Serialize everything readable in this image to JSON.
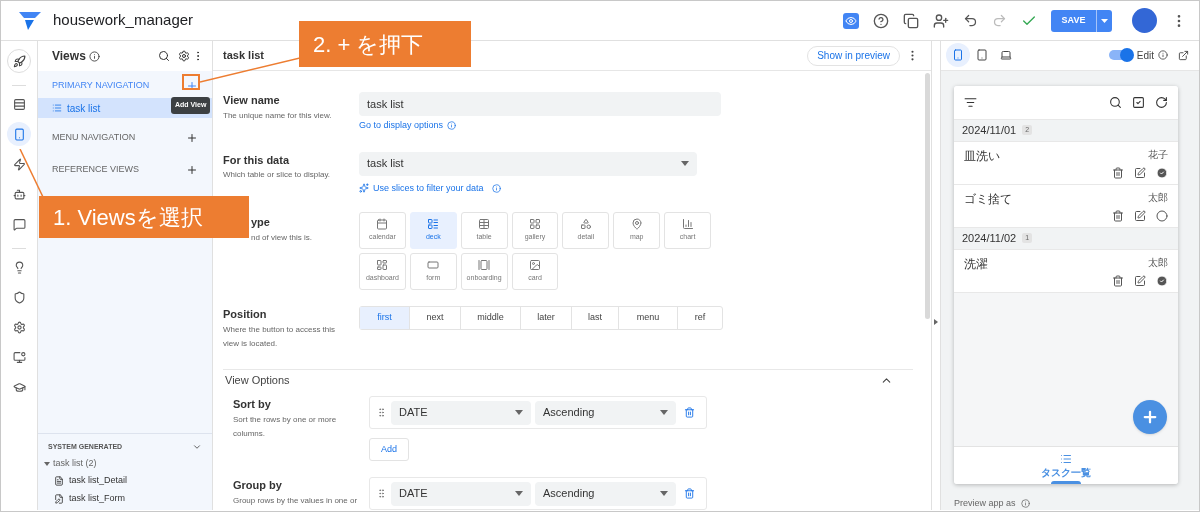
{
  "app": {
    "title": "housework_manager"
  },
  "toolbar": {
    "save_label": "SAVE"
  },
  "rail": [
    {
      "kind": "start",
      "selected": false
    },
    {
      "kind": "data",
      "selected": false
    },
    {
      "kind": "views",
      "selected": true
    },
    {
      "kind": "actions",
      "selected": false
    },
    {
      "kind": "automation",
      "selected": false
    },
    {
      "kind": "chat",
      "selected": false
    },
    {
      "kind": "intelligence",
      "selected": false
    },
    {
      "kind": "security",
      "selected": false
    },
    {
      "kind": "settings",
      "selected": false
    },
    {
      "kind": "manage",
      "selected": false
    },
    {
      "kind": "learn",
      "selected": false
    }
  ],
  "views_panel": {
    "title": "Views",
    "sections": [
      {
        "title": "PRIMARY NAVIGATION",
        "active": true,
        "items": [
          {
            "label": "task list",
            "selected": true
          }
        ]
      },
      {
        "title": "MENU NAVIGATION",
        "active": false
      },
      {
        "title": "REFERENCE VIEWS",
        "active": false
      }
    ],
    "tooltip": "Add View",
    "system": {
      "title": "SYSTEM GENERATED",
      "groups": [
        {
          "label": "task list (2)",
          "expanded": true,
          "children": [
            {
              "label": "task list_Detail",
              "kind": "detail"
            },
            {
              "label": "task list_Form",
              "kind": "form"
            }
          ]
        }
      ]
    }
  },
  "editor": {
    "title": "task list",
    "preview_button": "Show in preview",
    "view_name": {
      "label": "View name",
      "hint": "The unique name for this view.",
      "value": "task list",
      "link": "Go to display options"
    },
    "data": {
      "label": "For this data",
      "hint": "Which table or slice to display.",
      "value": "task list",
      "link": "Use slices to filter your data"
    },
    "view_type": {
      "label": "ype",
      "hint": "nd of view this is.",
      "options": [
        {
          "kind": "calendar",
          "label": "calendar",
          "selected": false
        },
        {
          "kind": "deck",
          "label": "deck",
          "selected": true
        },
        {
          "kind": "table",
          "label": "table",
          "selected": false
        },
        {
          "kind": "gallery",
          "label": "gallery",
          "selected": false
        },
        {
          "kind": "detail",
          "label": "detail",
          "selected": false
        },
        {
          "kind": "map",
          "label": "map",
          "selected": false
        },
        {
          "kind": "chart",
          "label": "chart",
          "selected": false
        },
        {
          "kind": "dashboard",
          "label": "dashboard",
          "selected": false
        },
        {
          "kind": "form",
          "label": "form",
          "selected": false
        },
        {
          "kind": "onboarding",
          "label": "onboarding",
          "selected": false
        },
        {
          "kind": "card",
          "label": "card",
          "selected": false
        }
      ]
    },
    "position": {
      "label": "Position",
      "hint": "Where the button to access this view is located.",
      "options": [
        {
          "label": "first",
          "selected": true
        },
        {
          "label": "next",
          "selected": false
        },
        {
          "label": "middle",
          "selected": false
        },
        {
          "label": "later",
          "selected": false
        },
        {
          "label": "last",
          "selected": false
        },
        {
          "label": "menu",
          "selected": false
        },
        {
          "label": "ref",
          "selected": false
        }
      ]
    },
    "options_title": "View Options",
    "options_expanded": true,
    "sort": {
      "label": "Sort by",
      "hint": "Sort the rows by one or more columns.",
      "column": "DATE",
      "order": "Ascending",
      "add": "Add"
    },
    "group": {
      "label": "Group by",
      "hint": "Group rows by the values in one or",
      "column": "DATE",
      "order": "Ascending"
    }
  },
  "preview": {
    "devices": [
      {
        "kind": "phone",
        "selected": true
      },
      {
        "kind": "tablet",
        "selected": false
      },
      {
        "kind": "desktop",
        "selected": false
      }
    ],
    "edit": {
      "label": "Edit",
      "on": true
    },
    "groups": [
      {
        "date": "2024/11/01",
        "count": "2",
        "tasks": [
          {
            "name": "皿洗い",
            "assignee": "花子",
            "done": true
          },
          {
            "name": "ゴミ捨て",
            "assignee": "太郎",
            "done": false
          }
        ]
      },
      {
        "date": "2024/11/02",
        "count": "1",
        "tasks": [
          {
            "name": "洗濯",
            "assignee": "太郎",
            "done": true
          }
        ]
      }
    ],
    "nav": [
      {
        "label": "タスク一覧",
        "selected": true
      }
    ],
    "footer": "Preview app as"
  },
  "annotations": [
    {
      "text": "2. + を押下"
    },
    {
      "text": "1. Viewsを選択"
    }
  ]
}
